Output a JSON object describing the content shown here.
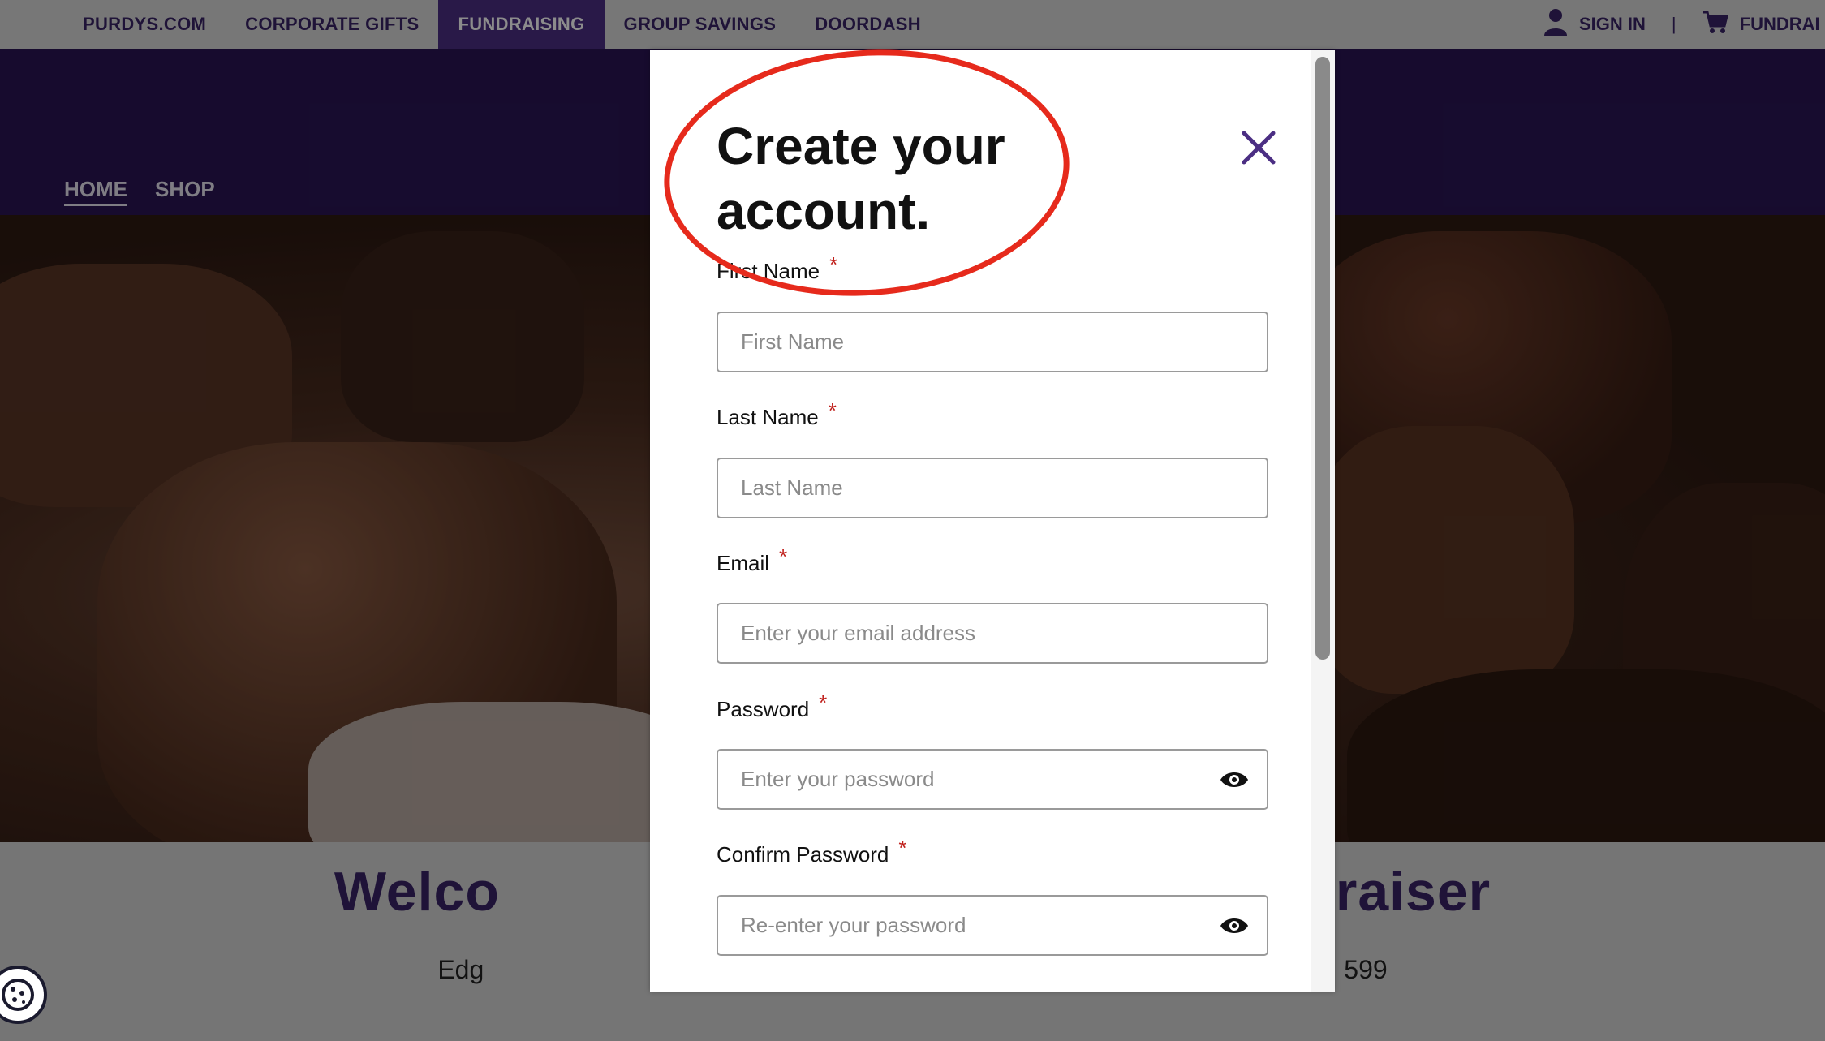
{
  "topbar": {
    "links": [
      "PURDYS.COM",
      "CORPORATE GIFTS",
      "FUNDRAISING",
      "GROUP SAVINGS",
      "DOORDASH"
    ],
    "sign_in": "SIGN IN",
    "separator": "|",
    "cart_label": "FUNDRAI"
  },
  "header": {
    "home": "HOME",
    "shop": "SHOP"
  },
  "welcome": {
    "left": "Welco",
    "right": "raiser"
  },
  "subline": {
    "left": "Edg",
    "right": "599"
  },
  "modal": {
    "title": "Create your account.",
    "fields": {
      "first_name": {
        "label": "First Name",
        "placeholder": "First Name",
        "required": "*"
      },
      "last_name": {
        "label": "Last Name",
        "placeholder": "Last Name",
        "required": "*"
      },
      "email": {
        "label": "Email",
        "placeholder": "Enter your email address",
        "required": "*"
      },
      "password": {
        "label": "Password",
        "placeholder": "Enter your password",
        "required": "*"
      },
      "confirm_password": {
        "label": "Confirm Password",
        "placeholder": "Re-enter your password",
        "required": "*"
      }
    }
  },
  "colors": {
    "brand_purple": "#3a2466",
    "header_bg": "#2a1555",
    "active_tab": "#4b2e83",
    "close_icon": "#4b2e83",
    "required_asterisk": "#c0201c",
    "annotation": "#e62a1c"
  }
}
